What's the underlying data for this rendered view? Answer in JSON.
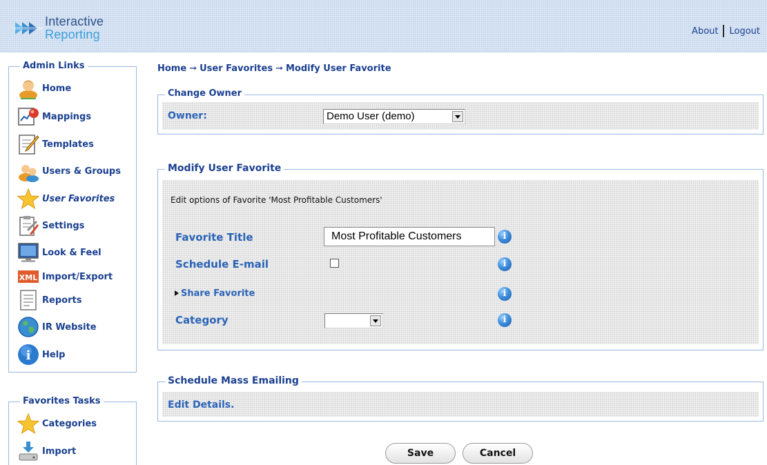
{
  "header": {
    "logo_line1": "Interactive",
    "logo_line2": "Reporting",
    "about": "About",
    "logout": "Logout"
  },
  "admin_links": {
    "title": "Admin Links",
    "items": [
      {
        "label": "Home",
        "icon": "user-icon"
      },
      {
        "label": "Mappings",
        "icon": "chart-icon"
      },
      {
        "label": "Templates",
        "icon": "pencil-document-icon"
      },
      {
        "label": "Users & Groups",
        "icon": "users-icon"
      },
      {
        "label": "User Favorites",
        "icon": "star-icon",
        "active": true
      },
      {
        "label": "Settings",
        "icon": "clipboard-tools-icon"
      },
      {
        "label": "Look & Feel",
        "icon": "monitor-icon"
      },
      {
        "label": "Import/Export",
        "icon": "xml-icon",
        "icon_text": "XML"
      },
      {
        "label": "Reports",
        "icon": "report-document-icon"
      },
      {
        "label": "IR Website",
        "icon": "globe-icon"
      },
      {
        "label": "Help",
        "icon": "info-icon",
        "icon_text": "i"
      }
    ]
  },
  "favorites_tasks": {
    "title": "Favorites Tasks",
    "items": [
      {
        "label": "Categories",
        "icon": "star-icon"
      },
      {
        "label": "Import",
        "icon": "import-icon"
      }
    ]
  },
  "breadcrumb": {
    "home": "Home",
    "user_favorites": "User Favorites",
    "current": "Modify User Favorite",
    "separator": "➞"
  },
  "change_owner": {
    "title": "Change Owner",
    "owner_label": "Owner:",
    "owner_value": "Demo User (demo)"
  },
  "modify_favorite": {
    "title": "Modify User Favorite",
    "description": "Edit options of Favorite 'Most Profitable Customers'",
    "favorite_title_label": "Favorite Title",
    "favorite_title_value": "Most Profitable Customers",
    "schedule_email_label": "Schedule E-mail",
    "schedule_email_checked": false,
    "share_favorite_label": "Share Favorite",
    "category_label": "Category",
    "category_value": "",
    "info_glyph": "i"
  },
  "mass_email": {
    "title": "Schedule Mass Emailing",
    "edit_details": "Edit Details."
  },
  "actions": {
    "save": "Save",
    "cancel": "Cancel"
  },
  "colors": {
    "accent": "#1a3f8f",
    "label": "#2a63b8",
    "border": "#98b8e0"
  }
}
